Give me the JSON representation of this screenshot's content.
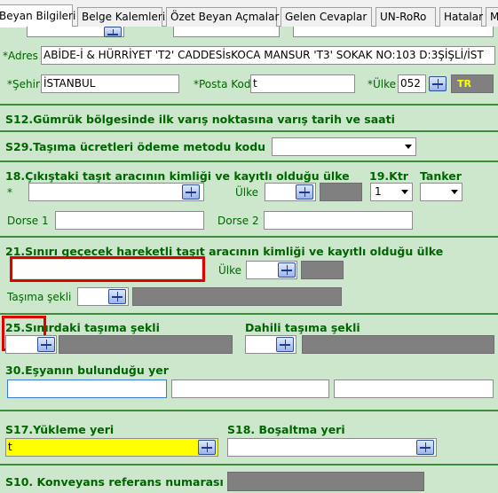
{
  "tabs": [
    "Beyan Bilgileri",
    "Belge Kalemleri",
    "Özet Beyan Açmalar",
    "Gelen Cevaplar",
    "UN-RoRo",
    "Hatalar",
    "M"
  ],
  "adres": {
    "label": "*Adres",
    "value": "ABİDE-İ & HÜRRİYET 'T2' CADDESİsKOCA MANSUR 'T3' SOKAK NO:103 D:3ŞİŞLİ/İST"
  },
  "sehir": {
    "label": "*Şehir",
    "value": "İSTANBUL"
  },
  "posta": {
    "label": "*Posta Kodu",
    "value": "t"
  },
  "ulke": {
    "label": "*Ülke",
    "value": "052",
    "badge": "TR"
  },
  "s12": "S12.Gümrük bölgesinde ilk varış noktasına varış tarih ve saati",
  "s29": "S29.Taşıma ücretleri ödeme metodu kodu",
  "s18": {
    "title": "18.Çıkıştaki taşıt aracının kimliği ve kayıtlı olduğu ülke",
    "star": "*",
    "ulke": "Ülke",
    "ktr": "19.Ktr",
    "ktr_value": "1",
    "tanker": "Tanker",
    "dorse1": "Dorse 1",
    "dorse2": "Dorse 2"
  },
  "s21": {
    "title": "21.Sınırı geçecek hareketli taşıt aracının kimliği ve kayıtlı olduğu ülke",
    "ulke": "Ülke",
    "tasima": "Taşıma şekli"
  },
  "s25": {
    "title": "25.Sınırdaki taşıma şekli",
    "dahili": "Dahili taşıma şekli"
  },
  "s30": "30.Eşyanın bulunduğu yer",
  "s17": {
    "title": "S17.Yükleme yeri",
    "value": "t"
  },
  "s18b": "S18. Boşaltma yeri",
  "s10": "S10. Konveyans referans numarası",
  "colors": {
    "accent_green": "#006400",
    "highlight_yellow": "#ffff00",
    "error_red": "#e00000"
  }
}
